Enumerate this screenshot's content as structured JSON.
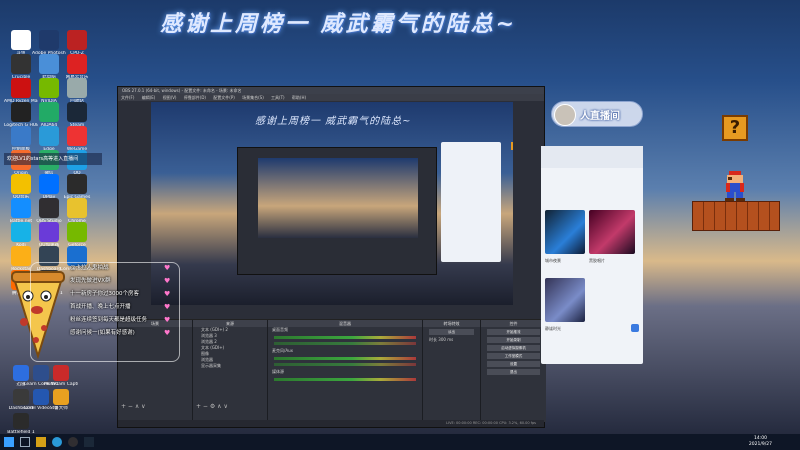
{
  "banner": {
    "title": "感谢上周榜一 威武霸气的陆总~"
  },
  "desktop": {
    "icons": [
      {
        "label": "斗鱼",
        "color": "#ffffff"
      },
      {
        "label": "Adobe Photoshop",
        "color": "#1f3a6b"
      },
      {
        "label": "CPU-Z",
        "color": "#b22"
      },
      {
        "label": "Crucible",
        "color": "#333"
      },
      {
        "label": "此电脑",
        "color": "#4a8fd8"
      },
      {
        "label": "网易云音乐",
        "color": "#d22"
      },
      {
        "label": "AMD Ryzen Master",
        "color": "#c11"
      },
      {
        "label": "NVIDIA",
        "color": "#76b900"
      },
      {
        "label": "回收站",
        "color": "#9aa"
      },
      {
        "label": "Logitech G HUB",
        "color": "#222"
      },
      {
        "label": "AIDA64",
        "color": "#2a6"
      },
      {
        "label": "Steam",
        "color": "#1b2838"
      },
      {
        "label": "控制面板",
        "color": "#3a7ac8"
      },
      {
        "label": "Edge",
        "color": "#2a9ad8"
      },
      {
        "label": "WeGame",
        "color": "#e33"
      },
      {
        "label": "Origin",
        "color": "#f56c2d"
      },
      {
        "label": "微信",
        "color": "#2aae67"
      },
      {
        "label": "QQ",
        "color": "#1ea0e6"
      },
      {
        "label": "QQ音乐",
        "color": "#f3c000"
      },
      {
        "label": "UPlay",
        "color": "#0070ff"
      },
      {
        "label": "Epic Games",
        "color": "#2b2b2b"
      },
      {
        "label": "Battle.net",
        "color": "#148eff"
      },
      {
        "label": "OBS Studio",
        "color": "#302e31"
      },
      {
        "label": "Chrome",
        "color": "#e8c22e"
      },
      {
        "label": "Kodi",
        "color": "#17b2e7"
      },
      {
        "label": "UU加速器",
        "color": "#6a3bd8"
      },
      {
        "label": "Geforce",
        "color": "#76b900"
      },
      {
        "label": "Rockstar",
        "color": "#fcaf17"
      },
      {
        "label": "Dashboard",
        "color": "#345"
      },
      {
        "label": "Corel VideoStudio",
        "color": "#1a6fd0"
      },
      {
        "label": "腾讯视频",
        "color": "#ff6a00"
      },
      {
        "label": "Battlefield 1",
        "color": "#333"
      }
    ],
    "bottom_icons": [
      {
        "label": "迅雷",
        "color": "#2d6ee0"
      },
      {
        "label": "Learn Corel VideoStudio",
        "color": "#2e4e8c"
      },
      {
        "label": "MultiCam Capture Lite",
        "color": "#c92a2a"
      },
      {
        "label": "Dashboard",
        "color": "#3a3a3a"
      },
      {
        "label": "Corel VideoStudio",
        "color": "#2457b0"
      },
      {
        "label": "鲁大师",
        "color": "#e8a020"
      },
      {
        "label": "Battlefield 1",
        "color": "#2b2b2b"
      }
    ]
  },
  "notice": "欢迎LV1的stars高等进入直播间",
  "badge": {
    "label": "人直播间"
  },
  "chat": {
    "lines": [
      "@卡拉人鬼拍战",
      "发现先做进VX群",
      "十一新房子你过3000个房客",
      "首战开播、晚上七点开播",
      "粉丝连续签到每天都是超级任务",
      "感谢问候一(如果有好感谢)"
    ]
  },
  "obs": {
    "title": "OBS 27.0.1 (64-bit, windows) - 配置文件: 未命名 - 场景: 未命名",
    "menu": [
      "文件(F)",
      "编辑(E)",
      "视图(V)",
      "停靠部件(D)",
      "配置文件(P)",
      "场景集合(S)",
      "工具(T)",
      "帮助(H)"
    ],
    "docks": {
      "scenes_label": "场景",
      "sources_label": "来源",
      "mixer_label": "混音器",
      "transitions_label": "转场特效",
      "controls_label": "控件",
      "sources": [
        "文本 (GDI+) 2",
        "浏览器 3",
        "浏览器 2",
        "文本 (GDI+)",
        "图像",
        "浏览器",
        "显示器采集"
      ],
      "mixer_channels": [
        "桌面音频",
        "麦克风/Aux",
        "媒体源"
      ],
      "transition_value": "淡出",
      "duration_label": "时长",
      "duration_value": "300 ms",
      "controls": [
        "开始推流",
        "开始录制",
        "启动虚拟摄像机",
        "工作室模式",
        "设置",
        "退出"
      ]
    },
    "status": "LIVE: 00:00:00   REC: 00:00:00   CPU: 3.2%, 60.00 fps"
  },
  "browser": {
    "captions": [
      "城市夜景",
      "黑胶唱片",
      "静谧时光"
    ]
  },
  "mario": {
    "block_glyph": "?"
  },
  "taskbar": {
    "time": "14:00",
    "date": "2021/9/27"
  }
}
